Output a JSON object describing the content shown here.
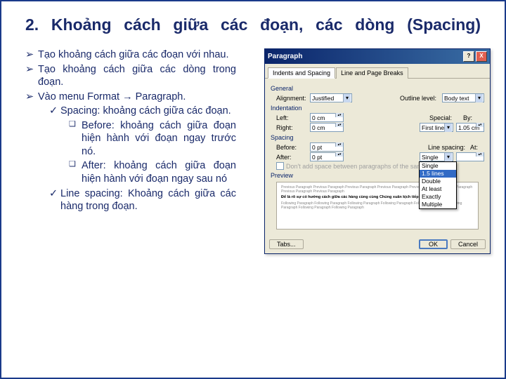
{
  "title": "2. Khoảng cách giữa các đoạn, các dòng (Spacing)",
  "bullets": {
    "b1": "Tạo khoảng cách giữa các đoạn với nhau.",
    "b2": "Tạo khoảng cách giữa các dòng trong đoạn.",
    "b3": "Vào menu Format → Paragraph.",
    "s1": "Spacing: khoảng cách giữa các đoạn.",
    "s1a": "Before: khoảng cách giữa đoạn hiện hành với đoạn ngay trước nó.",
    "s1b": "After: khoảng cách giữa đoạn hiện hành với đoạn ngay sau nó",
    "s2": "Line spacing: Khoảng cách giữa các hàng trong đoạn."
  },
  "dialog": {
    "title": "Paragraph",
    "help": "?",
    "close": "X",
    "tabs": {
      "t1": "Indents and Spacing",
      "t2": "Line and Page Breaks"
    },
    "general": {
      "label": "General",
      "alignment_lbl": "Alignment:",
      "alignment_val": "Justified",
      "outline_lbl": "Outline level:",
      "outline_val": "Body text"
    },
    "indent": {
      "label": "Indentation",
      "left_lbl": "Left:",
      "left_val": "0 cm",
      "right_lbl": "Right:",
      "right_val": "0 cm",
      "special_lbl": "Special:",
      "special_val": "First line",
      "by_lbl": "By:",
      "by_val": "1.05 cm"
    },
    "spacing": {
      "label": "Spacing",
      "before_lbl": "Before:",
      "before_val": "0 pt",
      "after_lbl": "After:",
      "after_val": "0 pt",
      "line_lbl": "Line spacing:",
      "line_val": "Single",
      "at_lbl": "At:",
      "at_val": "",
      "check": "Don't add space between paragraphs of the same style"
    },
    "dropdown": {
      "o1": "Single",
      "o2": "1.5 lines",
      "o3": "Double",
      "o4": "At least",
      "o5": "Exactly",
      "o6": "Multiple"
    },
    "preview": {
      "label": "Preview",
      "grey1": "Previous Paragraph Previous Paragraph Previous Paragraph Previous Paragraph Previous Paragraph Previous Paragraph Previous Paragraph Previous Paragraph",
      "main": "Để là rõ sự có hướng cách giữa các hàng cùng cùng Chúng xuân kịch tiếp sự",
      "grey2": "Following Paragraph Following Paragraph Following Paragraph Following Paragraph Following Paragraph Following Paragraph Following Paragraph Following Paragraph"
    },
    "buttons": {
      "tabs": "Tabs...",
      "ok": "OK",
      "cancel": "Cancel"
    }
  }
}
